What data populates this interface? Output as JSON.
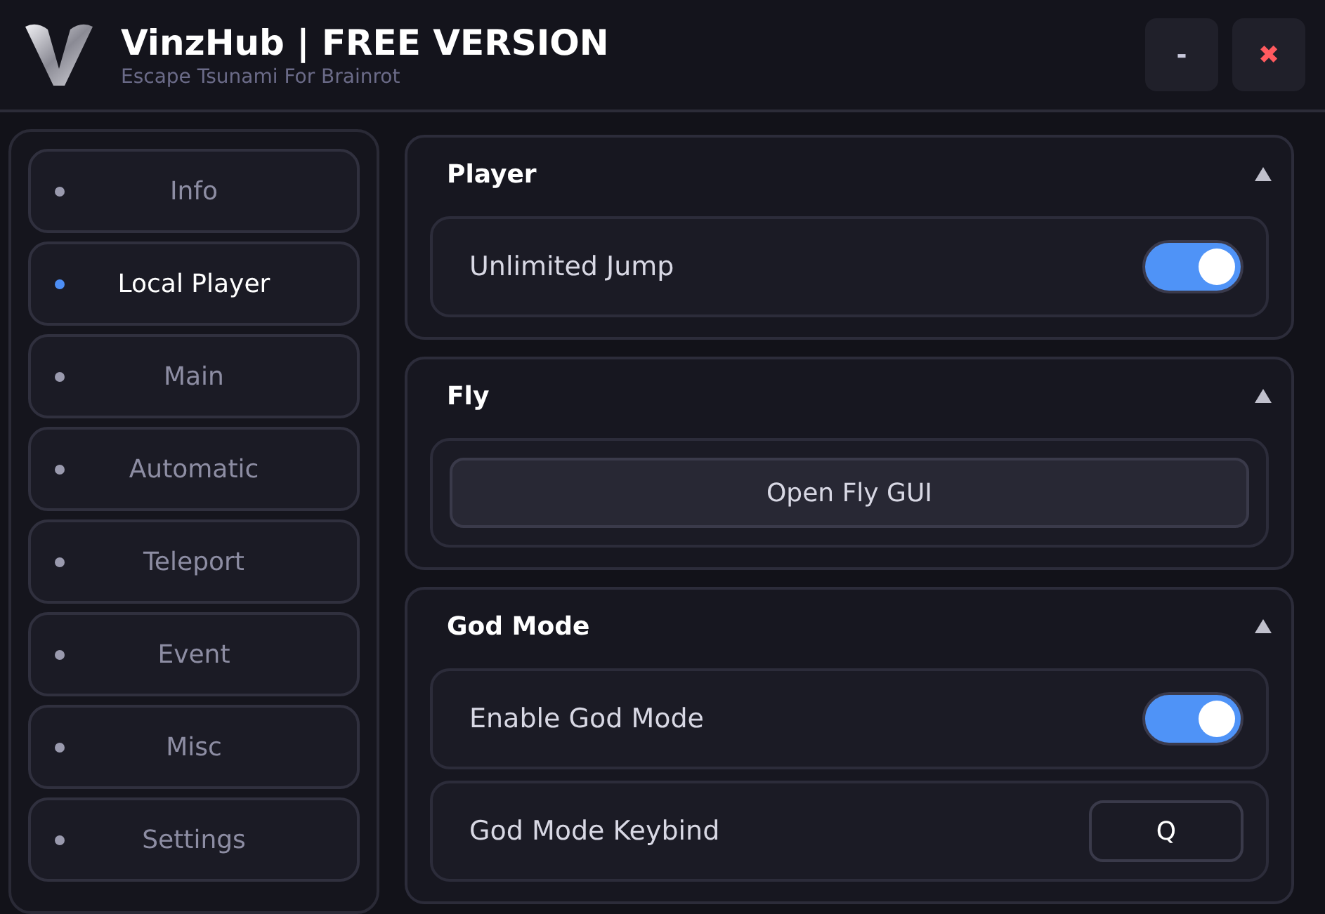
{
  "window": {
    "title": "VinzHub | FREE VERSION",
    "subtitle": "Escape Tsunami For Brainrot",
    "buttons": [
      {
        "kind": "minimize",
        "label": "-"
      },
      {
        "kind": "close",
        "label": "✖"
      }
    ]
  },
  "sidebar": {
    "items": [
      {
        "label": "Info",
        "selected": false
      },
      {
        "label": "Local Player",
        "selected": true
      },
      {
        "label": "Main",
        "selected": false
      },
      {
        "label": "Automatic",
        "selected": false
      },
      {
        "label": "Teleport",
        "selected": false
      },
      {
        "label": "Event",
        "selected": false
      },
      {
        "label": "Misc",
        "selected": false
      },
      {
        "label": "Settings",
        "selected": false
      }
    ]
  },
  "sections": [
    {
      "title": "Player",
      "expanded": true,
      "items": [
        {
          "kind": "toggle",
          "label": "Unlimited Jump",
          "on": true
        }
      ]
    },
    {
      "title": "Fly",
      "expanded": true,
      "items": [
        {
          "kind": "button",
          "label": "Open Fly GUI"
        }
      ]
    },
    {
      "title": "God Mode",
      "expanded": true,
      "items": [
        {
          "kind": "toggle",
          "label": "Enable God Mode",
          "on": true
        },
        {
          "kind": "keybind",
          "label": "God Mode Keybind",
          "value": "Q"
        }
      ]
    }
  ]
}
